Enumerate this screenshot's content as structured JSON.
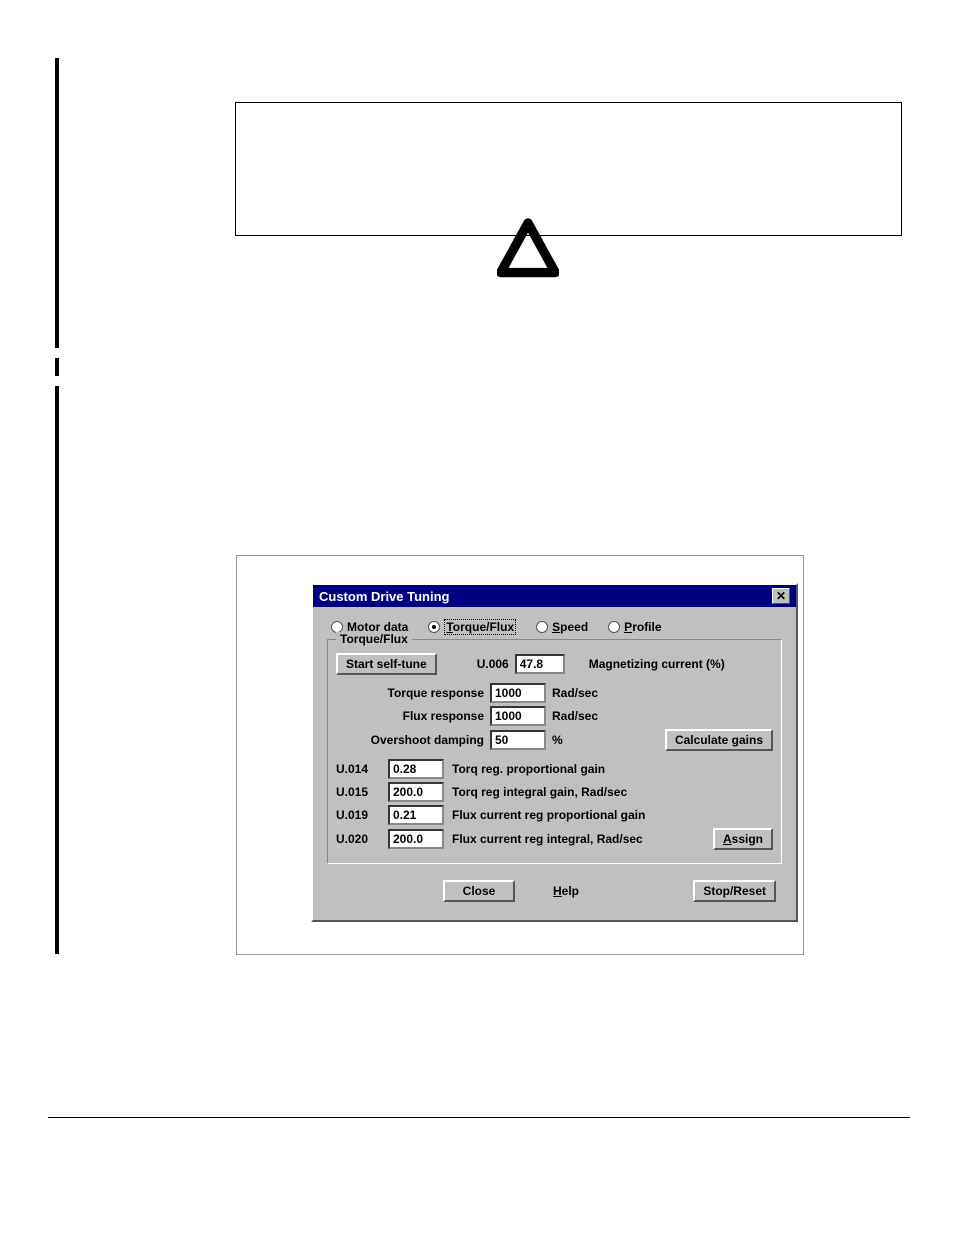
{
  "dialog": {
    "title": "Custom Drive Tuning",
    "radios": {
      "motor": "Motor data",
      "torque": "Torque/Flux",
      "speed": "Speed",
      "profile": "Profile"
    },
    "group_label": "Torque/Flux",
    "start_self_tune": "Start self-tune",
    "u006_code": "U.006",
    "u006_value": "47.8",
    "u006_label": "Magnetizing current (%)",
    "torque_response_label": "Torque response",
    "torque_response_value": "1000",
    "flux_response_label": "Flux response",
    "flux_response_value": "1000",
    "overshoot_label": "Overshoot damping",
    "overshoot_value": "50",
    "rad_sec": "Rad/sec",
    "percent_sign": "%",
    "calc_gains": "Calculate gains",
    "params": [
      {
        "code": "U.014",
        "value": "0.28",
        "desc": "Torq reg. proportional gain"
      },
      {
        "code": "U.015",
        "value": "200.0",
        "desc": "Torq reg integral gain, Rad/sec"
      },
      {
        "code": "U.019",
        "value": "0.21",
        "desc": "Flux current reg proportional gain"
      },
      {
        "code": "U.020",
        "value": "200.0",
        "desc": "Flux current reg integral, Rad/sec"
      }
    ],
    "assign": "Assign",
    "close": "Close",
    "help": "Help",
    "stop_reset": "Stop/Reset"
  }
}
